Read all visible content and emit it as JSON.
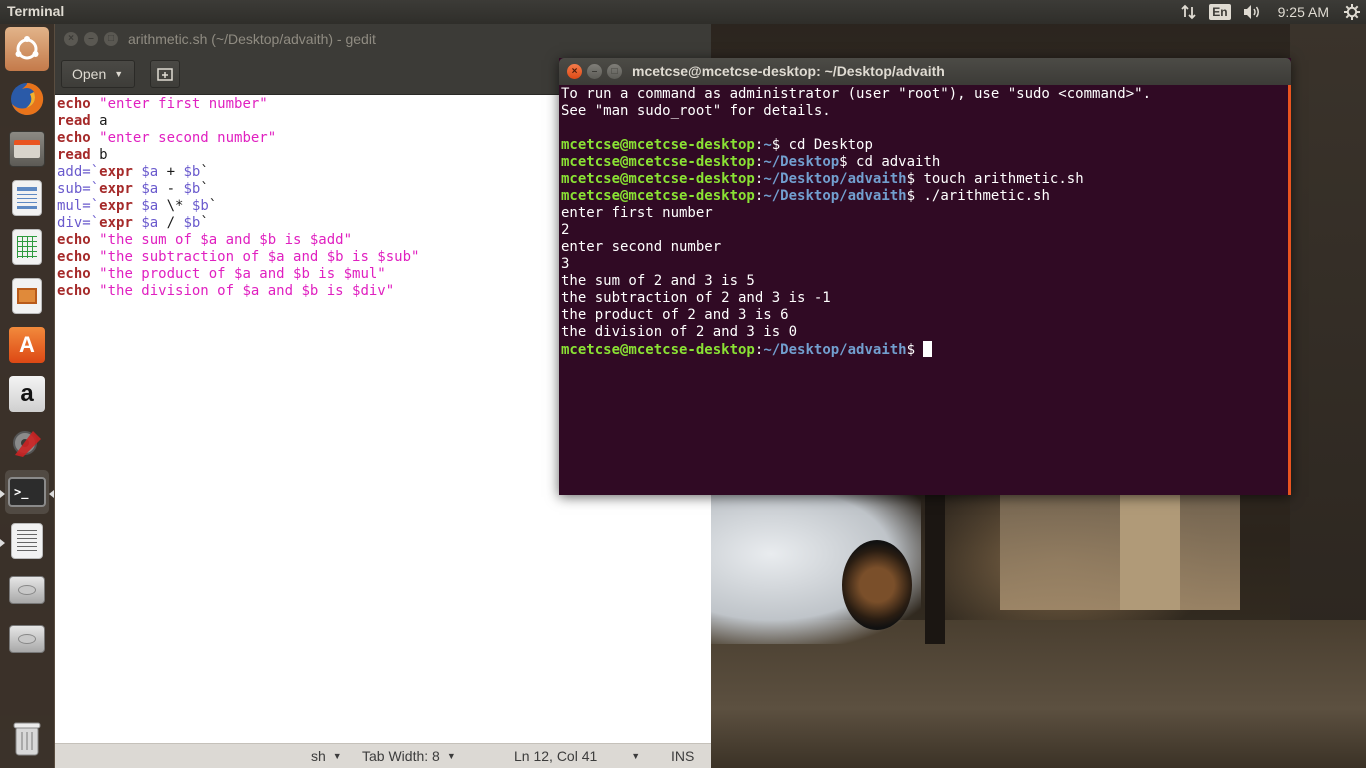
{
  "top_panel": {
    "app_title": "Terminal",
    "network_icon": "network-updown-icon",
    "keyboard_layout": "En",
    "volume_icon": "volume-icon",
    "clock": "9:25 AM",
    "settings_icon": "gear-icon"
  },
  "launcher": {
    "items": [
      {
        "name": "ubuntu-dash",
        "icon": "ubuntu-logo-icon"
      },
      {
        "name": "firefox",
        "icon": "firefox-icon"
      },
      {
        "name": "files",
        "icon": "files-icon"
      },
      {
        "name": "libreoffice-writer",
        "icon": "writer-icon"
      },
      {
        "name": "libreoffice-calc",
        "icon": "calc-icon"
      },
      {
        "name": "libreoffice-impress",
        "icon": "impress-icon"
      },
      {
        "name": "software-center",
        "icon": "software-center-icon"
      },
      {
        "name": "amazon",
        "icon": "amazon-icon"
      },
      {
        "name": "system-settings",
        "icon": "settings-tools-icon"
      },
      {
        "name": "terminal",
        "icon": "terminal-icon"
      },
      {
        "name": "gedit",
        "icon": "text-editor-icon"
      },
      {
        "name": "disk-1",
        "icon": "disk-icon"
      },
      {
        "name": "disk-2",
        "icon": "disk-icon"
      },
      {
        "name": "trash",
        "icon": "trash-icon"
      }
    ]
  },
  "gedit": {
    "title": "arithmetic.sh (~/Desktop/advaith) - gedit",
    "open_label": "Open",
    "status": {
      "language": "sh",
      "tab_width": "Tab Width: 8",
      "position": "Ln 12, Col 41",
      "mode": "INS"
    },
    "code_lines": [
      {
        "kw": "echo",
        "rest": " \"enter first number\""
      },
      {
        "kw": "read",
        "rest": " a"
      },
      {
        "kw": "echo",
        "rest": " \"enter second number\""
      },
      {
        "kw": "read",
        "rest": " b"
      },
      {
        "pre": "add=`",
        "kw": "expr",
        "rest": " $a + $b`"
      },
      {
        "pre": "sub=`",
        "kw": "expr",
        "rest": " $a - $b`"
      },
      {
        "pre": "mul=`",
        "kw": "expr",
        "rest": " $a \\* $b`"
      },
      {
        "pre": "div=`",
        "kw": "expr",
        "rest": " $a / $b`"
      },
      {
        "kw": "echo",
        "rest": " \"the sum of $a and $b is $add\""
      },
      {
        "kw": "echo",
        "rest": " \"the subtraction of $a and $b is $sub\""
      },
      {
        "kw": "echo",
        "rest": " \"the product of $a and $b is $mul\""
      },
      {
        "kw": "echo",
        "rest": " \"the division of $a and $b is $div\""
      }
    ]
  },
  "terminal": {
    "title": "mcetcse@mcetcse-desktop: ~/Desktop/advaith",
    "prompt_user": "mcetcse@mcetcse-desktop",
    "lines": [
      {
        "type": "out",
        "text": "To run a command as administrator (user \"root\"), use \"sudo <command>\"."
      },
      {
        "type": "out",
        "text": "See \"man sudo_root\" for details."
      },
      {
        "type": "out",
        "text": ""
      },
      {
        "type": "cmd",
        "path": "~",
        "cmd": " cd Desktop"
      },
      {
        "type": "cmd",
        "path": "~/Desktop",
        "cmd": " cd advaith"
      },
      {
        "type": "cmd",
        "path": "~/Desktop/advaith",
        "cmd": " touch arithmetic.sh"
      },
      {
        "type": "cmd",
        "path": "~/Desktop/advaith",
        "cmd": " ./arithmetic.sh"
      },
      {
        "type": "out",
        "text": "enter first number"
      },
      {
        "type": "out",
        "text": "2"
      },
      {
        "type": "out",
        "text": "enter second number"
      },
      {
        "type": "out",
        "text": "3"
      },
      {
        "type": "out",
        "text": "the sum of 2 and 3 is 5"
      },
      {
        "type": "out",
        "text": "the subtraction of 2 and 3 is -1"
      },
      {
        "type": "out",
        "text": "the product of 2 and 3 is 6"
      },
      {
        "type": "out",
        "text": "the division of 2 and 3 is 0"
      },
      {
        "type": "prompt",
        "path": "~/Desktop/advaith",
        "cmd": " "
      }
    ]
  },
  "colors": {
    "terminal_bg": "#300a24",
    "prompt_user": "#8ae234",
    "prompt_path": "#729fcf",
    "ubuntu_orange": "#e95420",
    "keyword": "#a52a2a",
    "string": "#e020c0"
  }
}
